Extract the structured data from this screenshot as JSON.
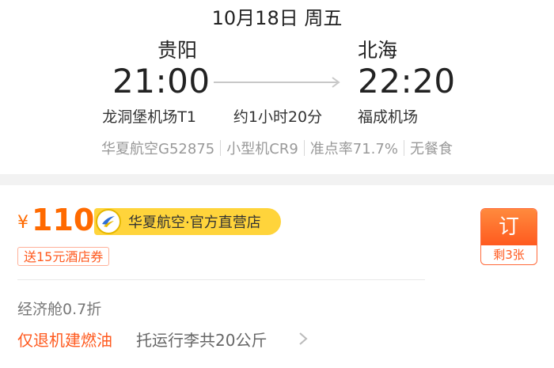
{
  "flight": {
    "date": "10月18日 周五",
    "departure": {
      "city": "贵阳",
      "time": "21:00",
      "airport": "龙洞堡机场T1"
    },
    "arrival": {
      "city": "北海",
      "time": "22:20",
      "airport": "福成机场"
    },
    "duration": "约1小时20分",
    "meta": {
      "airline_flight": "华夏航空G52875",
      "aircraft": "小型机CR9",
      "on_time_rate": "准点率71.7%",
      "meal": "无餐食"
    }
  },
  "fare": {
    "currency": "¥",
    "price": "110",
    "airline_badge": "华夏航空·官方直营店",
    "coupon": "送15元酒店券",
    "cabin": "经济舱0.7折",
    "refund_rule": "仅退机建燃油",
    "baggage": "托运行李共20公斤",
    "book_label": "订",
    "seats_left": "剩3张"
  },
  "colors": {
    "accent": "#ff6a00",
    "badge_bg": "#ffd43b",
    "coupon_text": "#ff5a1f",
    "muted_text": "#999999"
  }
}
